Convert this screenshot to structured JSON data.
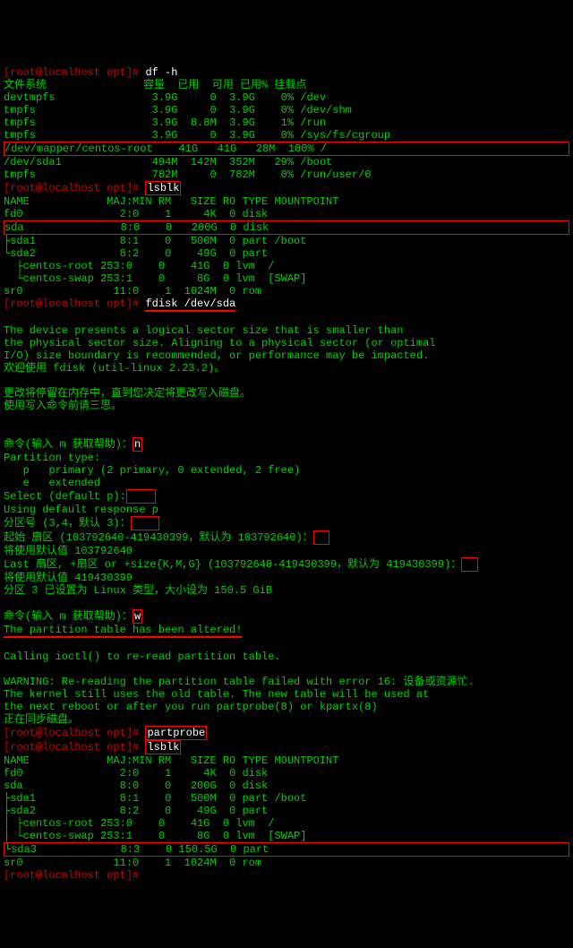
{
  "prompts": {
    "p": "[root@localhost opt]# "
  },
  "commands": {
    "df": "df -h",
    "lsblk": "lsblk",
    "fdisk": "fdisk /dev/sda",
    "partprobe": "partprobe"
  },
  "df": {
    "header": "文件系统               容量  已用  可用 已用% 挂载点",
    "rows": [
      "devtmpfs               3.9G     0  3.9G    0% /dev",
      "tmpfs                  3.9G     0  3.9G    0% /dev/shm",
      "tmpfs                  3.9G  8.8M  3.9G    1% /run",
      "tmpfs                  3.9G     0  3.9G    0% /sys/fs/cgroup"
    ],
    "highlight": "/dev/mapper/centos-root    41G   41G   28M  100% /",
    "after": [
      "/dev/sda1              494M  142M  352M   29% /boot",
      "tmpfs                  782M     0  782M    0% /run/user/0"
    ]
  },
  "lsblk1": {
    "header": "NAME            MAJ:MIN RM   SIZE RO TYPE MOUNTPOINT",
    "row1": "fd0               2:0    1     4K  0 disk ",
    "hl": "sda               8:0    0   200G  0 disk ",
    "rows": [
      "├sda1             8:1    0   500M  0 part /boot",
      "└sda2             8:2    0    49G  0 part ",
      "  ├centos-root 253:0    0    41G  0 lvm  /",
      "  └centos-swap 253:1    0     8G  0 lvm  [SWAP]",
      "sr0              11:0    1  1024M  0 rom"
    ]
  },
  "fdisk_out": {
    "l1": "The device presents a logical sector size that is smaller than",
    "l2": "the physical sector size. Aligning to a physical sector (or optimal",
    "l3": "I/O) size boundary is recommended, or performance may be impacted.",
    "l4": "欢迎使用 fdisk (util-linux 2.23.2)。",
    "l5": "更改将停留在内存中，直到您决定将更改写入磁盘。",
    "l6": "使用写入命令前请三思。",
    "pr1": "命令(输入 m 获取帮助)：",
    "in1": "n",
    "pt": "Partition type:",
    "pt1": "   p   primary (2 primary, 0 extended, 2 free)",
    "pt2": "   e   extended",
    "sel": "Select (default p):",
    "selresp": "Using default response p",
    "pnum": "分区号 (3,4，默认 3)：",
    "start": "起始 扇区 (103792640-419430399，默认为 103792640)：",
    "startdef": "将使用默认值 103792640",
    "last": "Last 扇区, +扇区 or +size{K,M,G} (103792640-419430399，默认为 419430399)：",
    "lastdef": "将使用默认值 419430399",
    "setmsg": "分区 3 已设置为 Linux 类型，大小设为 150.5 GiB",
    "in2": "w",
    "altered": "The partition table has been altered!",
    "ioctl": "Calling ioctl() to re-read partition table.",
    "w1": "WARNING: Re-reading the partition table failed with error 16: 设备或资源忙.",
    "w2": "The kernel still uses the old table. The new table will be used at",
    "w3": "the next reboot or after you run partprobe(8) or kpartx(8)",
    "sync": "正在同步磁盘。"
  },
  "lsblk2": {
    "header": "NAME            MAJ:MIN RM   SIZE RO TYPE MOUNTPOINT",
    "rows1": [
      "fd0               2:0    1     4K  0 disk ",
      "sda               8:0    0   200G  0 disk ",
      "├sda1             8:1    0   500M  0 part /boot",
      "├sda2             8:2    0    49G  0 part ",
      "│ ├centos-root 253:0    0    41G  0 lvm  /",
      "│ └centos-swap 253:1    0     8G  0 lvm  [SWAP]"
    ],
    "hl": "└sda3             8:3    0 150.5G  0 part ",
    "rows2": [
      "sr0              11:0    1  1024M  0 rom"
    ]
  },
  "chart_data": {
    "type": "table",
    "title": "df -h output",
    "columns": [
      "Filesystem",
      "Size",
      "Used",
      "Avail",
      "Use%",
      "Mounted on"
    ],
    "rows": [
      [
        "devtmpfs",
        "3.9G",
        "0",
        "3.9G",
        "0%",
        "/dev"
      ],
      [
        "tmpfs",
        "3.9G",
        "0",
        "3.9G",
        "0%",
        "/dev/shm"
      ],
      [
        "tmpfs",
        "3.9G",
        "8.8M",
        "3.9G",
        "1%",
        "/run"
      ],
      [
        "tmpfs",
        "3.9G",
        "0",
        "3.9G",
        "0%",
        "/sys/fs/cgroup"
      ],
      [
        "/dev/mapper/centos-root",
        "41G",
        "41G",
        "28M",
        "100%",
        "/"
      ],
      [
        "/dev/sda1",
        "494M",
        "142M",
        "352M",
        "29%",
        "/boot"
      ],
      [
        "tmpfs",
        "782M",
        "0",
        "782M",
        "0%",
        "/run/user/0"
      ]
    ]
  }
}
